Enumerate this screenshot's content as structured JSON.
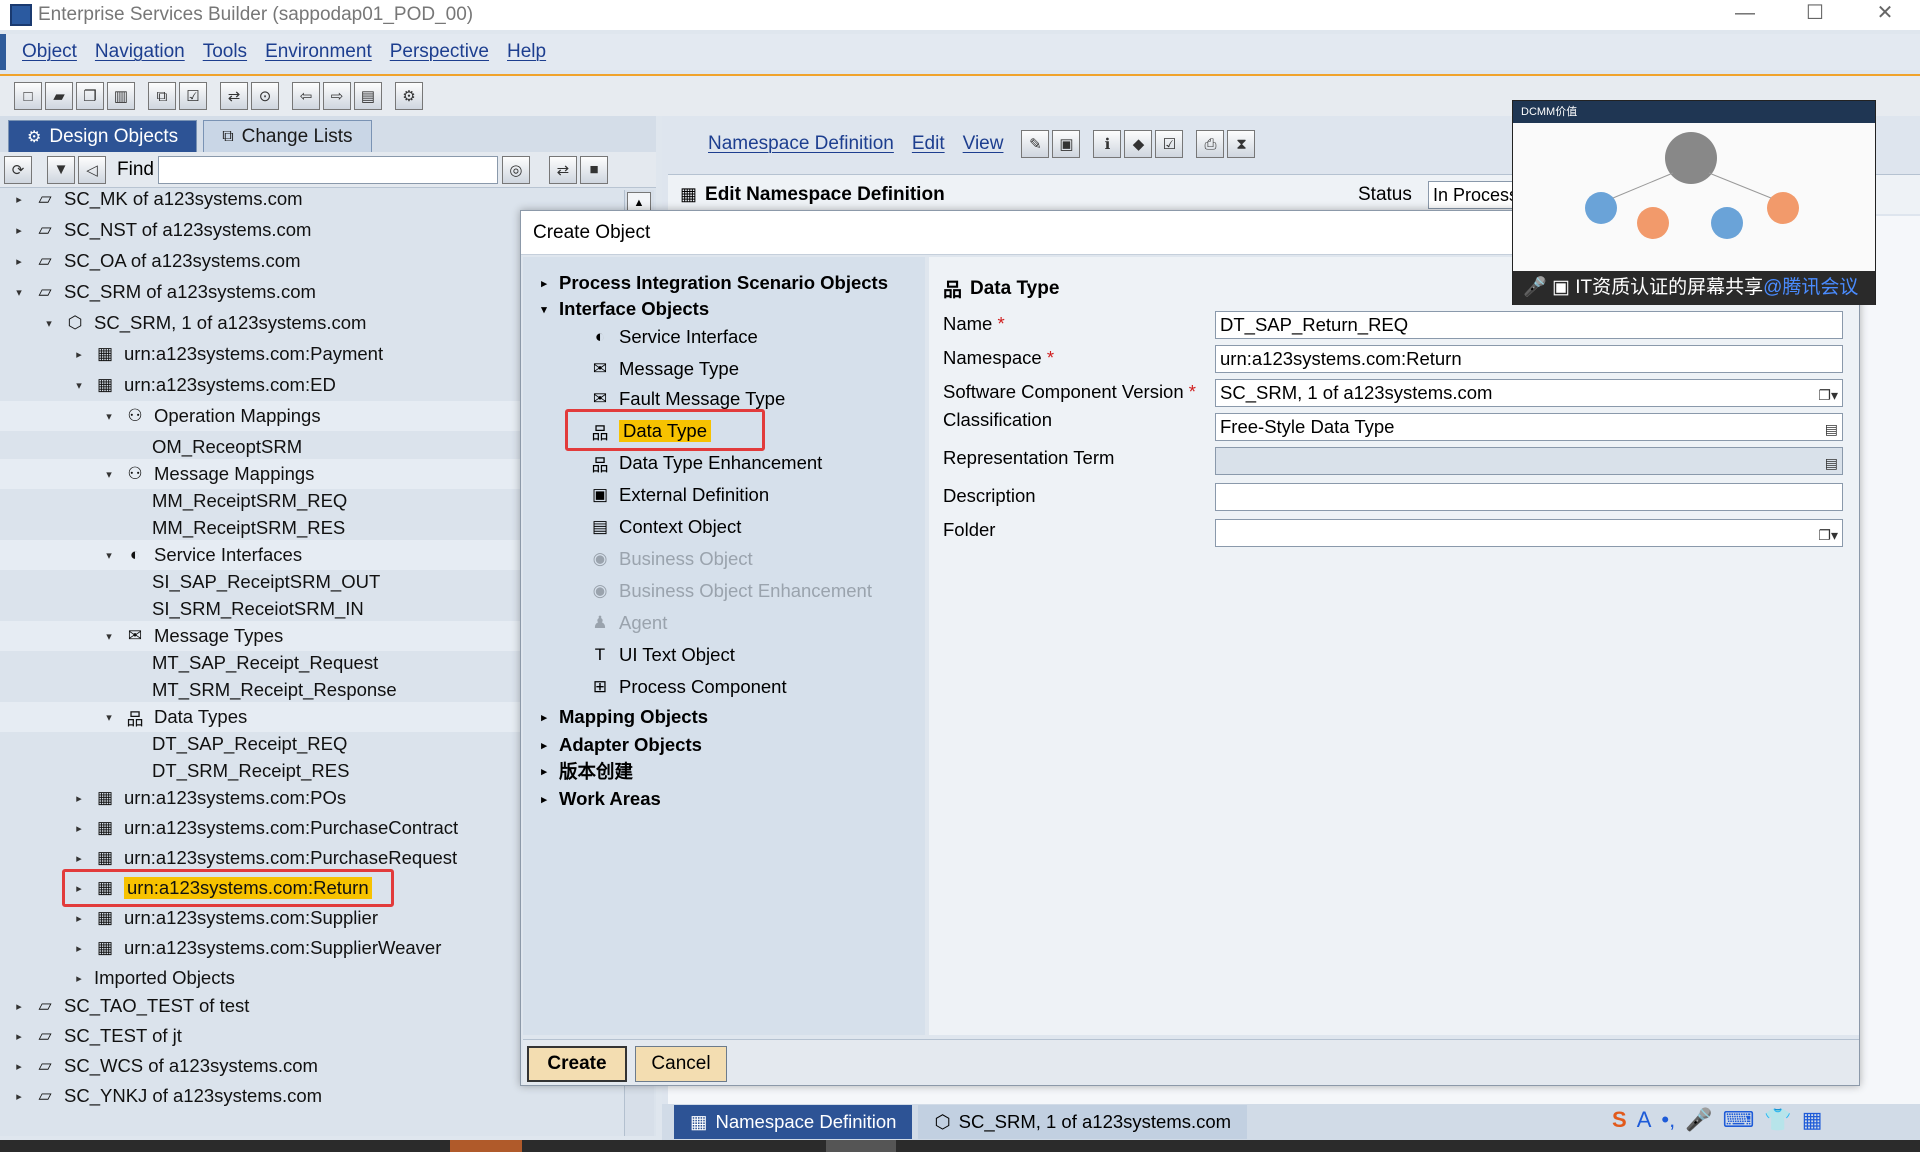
{
  "window": {
    "title": "Enterprise Services Builder (sappodap01_POD_00)",
    "minimize": "—",
    "maximize": "☐",
    "close": "✕"
  },
  "menu": [
    "Object",
    "Navigation",
    "Tools",
    "Environment",
    "Perspective",
    "Help"
  ],
  "left": {
    "tabs": {
      "design": "Design Objects",
      "changes": "Change Lists"
    },
    "find_label": "Find",
    "find_value": "",
    "tree": [
      {
        "label": "SC_MK of a123systems.com",
        "level": 0,
        "arrow": "▸",
        "icon": "▱"
      },
      {
        "label": "SC_NST of a123systems.com",
        "level": 0,
        "arrow": "▸",
        "icon": "▱"
      },
      {
        "label": "SC_OA of a123systems.com",
        "level": 0,
        "arrow": "▸",
        "icon": "▱"
      },
      {
        "label": "SC_SRM of a123systems.com",
        "level": 0,
        "arrow": "▾",
        "icon": "▱"
      },
      {
        "label": "SC_SRM, 1 of a123systems.com",
        "level": 1,
        "arrow": "▾",
        "icon": "⬡"
      },
      {
        "label": "urn:a123systems.com:Payment",
        "level": 2,
        "arrow": "▸",
        "icon": "▦"
      },
      {
        "label": "urn:a123systems.com:ED",
        "level": 2,
        "arrow": "▾",
        "icon": "▦"
      },
      {
        "label": "Operation Mappings",
        "level": 3,
        "arrow": "▾",
        "icon": "⚇"
      },
      {
        "label": "OM_ReceoptSRM",
        "level": 4,
        "arrow": "",
        "icon": ""
      },
      {
        "label": "Message Mappings",
        "level": 3,
        "arrow": "▾",
        "icon": "⚇"
      },
      {
        "label": "MM_ReceiptSRM_REQ",
        "level": 4,
        "arrow": "",
        "icon": ""
      },
      {
        "label": "MM_ReceiptSRM_RES",
        "level": 4,
        "arrow": "",
        "icon": ""
      },
      {
        "label": "Service Interfaces",
        "level": 3,
        "arrow": "▾",
        "icon": "◐"
      },
      {
        "label": "SI_SAP_ReceiptSRM_OUT",
        "level": 4,
        "arrow": "",
        "icon": ""
      },
      {
        "label": "SI_SRM_ReceiotSRM_IN",
        "level": 4,
        "arrow": "",
        "icon": ""
      },
      {
        "label": "Message Types",
        "level": 3,
        "arrow": "▾",
        "icon": "✉"
      },
      {
        "label": "MT_SAP_Receipt_Request",
        "level": 4,
        "arrow": "",
        "icon": ""
      },
      {
        "label": "MT_SRM_Receipt_Response",
        "level": 4,
        "arrow": "",
        "icon": ""
      },
      {
        "label": "Data Types",
        "level": 3,
        "arrow": "▾",
        "icon": "品"
      },
      {
        "label": "DT_SAP_Receipt_REQ",
        "level": 4,
        "arrow": "",
        "icon": ""
      },
      {
        "label": "DT_SRM_Receipt_RES",
        "level": 4,
        "arrow": "",
        "icon": ""
      },
      {
        "label": "urn:a123systems.com:POs",
        "level": 2,
        "arrow": "▸",
        "icon": "▦"
      },
      {
        "label": "urn:a123systems.com:PurchaseContract",
        "level": 2,
        "arrow": "▸",
        "icon": "▦"
      },
      {
        "label": "urn:a123systems.com:PurchaseRequest",
        "level": 2,
        "arrow": "▸",
        "icon": "▦"
      },
      {
        "label": "urn:a123systems.com:Return",
        "level": 2,
        "arrow": "▸",
        "icon": "▦",
        "highlight": true
      },
      {
        "label": "urn:a123systems.com:Supplier",
        "level": 2,
        "arrow": "▸",
        "icon": "▦"
      },
      {
        "label": "urn:a123systems.com:SupplierWeaver",
        "level": 2,
        "arrow": "▸",
        "icon": "▦"
      },
      {
        "label": "Imported Objects",
        "level": 2,
        "arrow": "▸",
        "icon": ""
      },
      {
        "label": "SC_TAO_TEST of test",
        "level": 0,
        "arrow": "▸",
        "icon": "▱"
      },
      {
        "label": "SC_TEST of jt",
        "level": 0,
        "arrow": "▸",
        "icon": "▱"
      },
      {
        "label": "SC_WCS of a123systems.com",
        "level": 0,
        "arrow": "▸",
        "icon": "▱"
      },
      {
        "label": "SC_YNKJ of a123systems.com",
        "level": 0,
        "arrow": "▸",
        "icon": "▱"
      }
    ]
  },
  "right": {
    "menu": [
      "Namespace Definition",
      "Edit",
      "View"
    ],
    "edit_title": "Edit Namespace Definition",
    "status_label": "Status",
    "status_value": "In Process"
  },
  "bottom_tabs": {
    "ns": "Namespace Definition",
    "swcv": "SC_SRM, 1 of a123systems.com"
  },
  "dialog": {
    "title": "Create Object",
    "tree": [
      {
        "label": "Process Integration Scenario Objects",
        "type": "group",
        "arrow": "▸"
      },
      {
        "label": "Interface Objects",
        "type": "group",
        "arrow": "▾"
      },
      {
        "label": "Service Interface",
        "type": "item",
        "icon": "◐"
      },
      {
        "label": "Message Type",
        "type": "item",
        "icon": "✉"
      },
      {
        "label": "Fault Message Type",
        "type": "item",
        "icon": "✉"
      },
      {
        "label": "Data Type",
        "type": "item",
        "icon": "品",
        "selected": true
      },
      {
        "label": "Data Type Enhancement",
        "type": "item",
        "icon": "品"
      },
      {
        "label": "External Definition",
        "type": "item",
        "icon": "▣"
      },
      {
        "label": "Context Object",
        "type": "item",
        "icon": "▤"
      },
      {
        "label": "Business Object",
        "type": "item",
        "icon": "◉",
        "disabled": true
      },
      {
        "label": "Business Object Enhancement",
        "type": "item",
        "icon": "◉",
        "disabled": true
      },
      {
        "label": "Agent",
        "type": "item",
        "icon": "♟",
        "disabled": true
      },
      {
        "label": "UI Text Object",
        "type": "item",
        "icon": "T"
      },
      {
        "label": "Process Component",
        "type": "item",
        "icon": "⊞"
      },
      {
        "label": "Mapping Objects",
        "type": "group",
        "arrow": "▸"
      },
      {
        "label": "Adapter Objects",
        "type": "group",
        "arrow": "▸"
      },
      {
        "label": "版本创建",
        "type": "group",
        "arrow": "▸"
      },
      {
        "label": "Work Areas",
        "type": "group",
        "arrow": "▸"
      }
    ],
    "form_title": "Data Type",
    "fields": {
      "name": {
        "label": "Name",
        "value": "DT_SAP_Return_REQ",
        "required": "*"
      },
      "namespace": {
        "label": "Namespace",
        "value": "urn:a123systems.com:Return",
        "required": "*"
      },
      "swcv": {
        "label": "Software Component Version",
        "value": "SC_SRM, 1 of a123systems.com",
        "required": "*"
      },
      "classification": {
        "label": "Classification",
        "value": "Free-Style Data Type"
      },
      "repterm": {
        "label": "Representation Term",
        "value": ""
      },
      "description": {
        "label": "Description",
        "value": ""
      },
      "folder": {
        "label": "Folder",
        "value": ""
      }
    },
    "buttons": {
      "create": "Create",
      "cancel": "Cancel"
    }
  },
  "video_overlay": {
    "header": "DCMM价值",
    "caption": "IT资质认证的屏幕共享",
    "brand": "@腾讯会议"
  },
  "colors": {
    "highlight": "#f7c200",
    "accent": "#2d5395",
    "callout": "#e23b3b"
  }
}
